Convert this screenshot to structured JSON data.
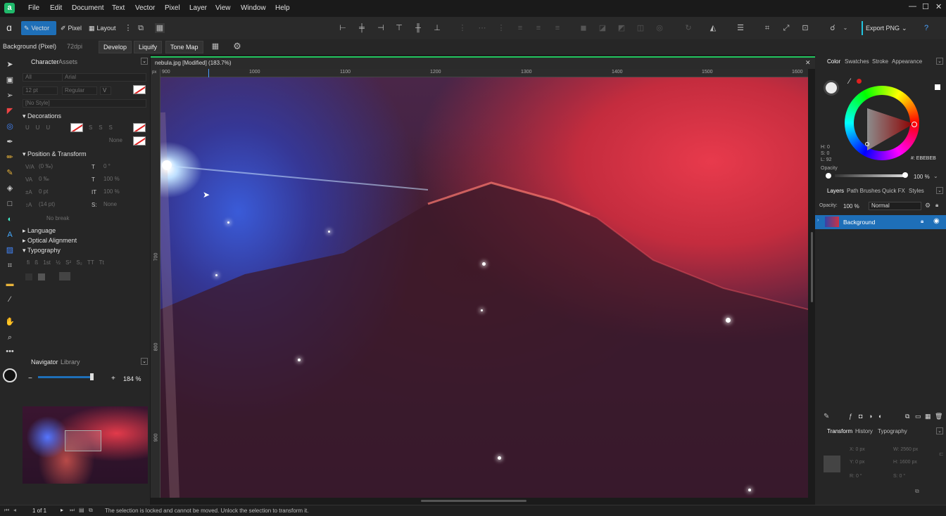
{
  "menu": [
    "File",
    "Edit",
    "Document",
    "Text",
    "Vector",
    "Pixel",
    "Layer",
    "View",
    "Window",
    "Help"
  ],
  "personas": {
    "vector": "Vector",
    "pixel": "Pixel",
    "layout": "Layout"
  },
  "export_label": "Export PNG",
  "context": {
    "layer_name": "Background (Pixel)",
    "dpi": "72dpi",
    "develop": "Develop",
    "liquify": "Liquify",
    "tone_map": "Tone Map"
  },
  "left": {
    "tabs": [
      "Character",
      "Assets"
    ],
    "font_style": "All",
    "font_name": "Arial",
    "font_size": "12 pt",
    "font_weight": "Regular",
    "no_style": "[No Style]",
    "decorations_title": "Decorations",
    "decor_none": "None",
    "position_title": "Position & Transform",
    "pos_fields": [
      "(0 ‰)",
      "0 ‰",
      "0 pt",
      "(14 pt)"
    ],
    "pos_right_fields": [
      "0 °",
      "100 %",
      "100 %",
      "None"
    ],
    "no_break": "No break",
    "language": "Language",
    "optical": "Optical Alignment",
    "typography": "Typography",
    "typo_glyphs": [
      "fi",
      "ß",
      "1st",
      "½",
      "S²",
      "S₂",
      "TT",
      "Tt"
    ],
    "nav_tabs": [
      "Navigator",
      "Library"
    ],
    "zoom": "184 %"
  },
  "document": {
    "tab_title": "nebula.jpg [Modified] (183.7%)",
    "ruler_px": "px",
    "ruler_h": [
      "900",
      "1000",
      "1100",
      "1200",
      "1300",
      "1400",
      "1500",
      "1600"
    ],
    "ruler_v": [
      "700",
      "800",
      "900"
    ]
  },
  "right": {
    "color_tabs": [
      "Color",
      "Swatches",
      "Stroke",
      "Appearance"
    ],
    "hsl": {
      "h": "H: 0",
      "s": "S: 0",
      "l": "L: 92"
    },
    "hex": "#: EBEBEB",
    "opacity_label": "Opacity",
    "opacity_val": "100 %",
    "layer_tabs": [
      "Layers",
      "Path Brushes",
      "Quick FX",
      "Styles"
    ],
    "layers_opacity_label": "Opacity:",
    "layers_opacity": "100 %",
    "blend": "Normal",
    "layer_name": "Background",
    "transform_tabs": [
      "Transform",
      "History",
      "Typography"
    ],
    "transform": {
      "x": "X: 0 px",
      "y": "Y: 0 px",
      "w": "W: 2560 px",
      "h": "H: 1600 px",
      "r": "R: 0 °",
      "s": "S: 0 °"
    }
  },
  "status": {
    "page": "1 of 1",
    "message": "The selection is locked and cannot be moved. Unlock the selection to transform it."
  },
  "colors": {
    "accent": "#1e6fb8",
    "brand": "#20b96b"
  }
}
